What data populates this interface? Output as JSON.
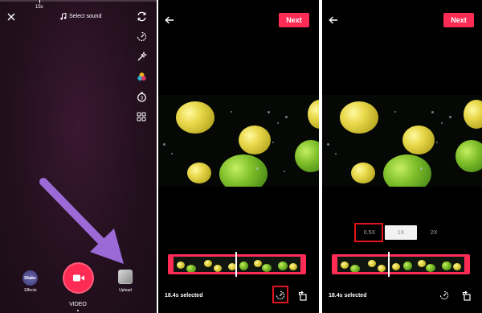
{
  "camera": {
    "timer_label": "15s",
    "select_sound_label": "Select sound",
    "effects_label": "Effects",
    "effects_thumb_text": "Shake",
    "upload_label": "Upload",
    "mode_label": "VIDEO",
    "right_icons": [
      "flip-icon",
      "speed-icon",
      "beauty-icon",
      "filters-icon",
      "timer-icon",
      "more-icon"
    ]
  },
  "trim": {
    "next_label": "Next",
    "selected_text": "18.4s selected"
  },
  "speed_view": {
    "next_label": "Next",
    "selected_text": "18.4s selected",
    "speeds": [
      "0.5X",
      "1X",
      "2X"
    ],
    "active_speed": "1X",
    "highlighted_speed": "0.5X"
  },
  "colors": {
    "accent": "#fe2c55",
    "annotation_red": "#e0151b",
    "arrow_purple": "#9b6ad6"
  }
}
